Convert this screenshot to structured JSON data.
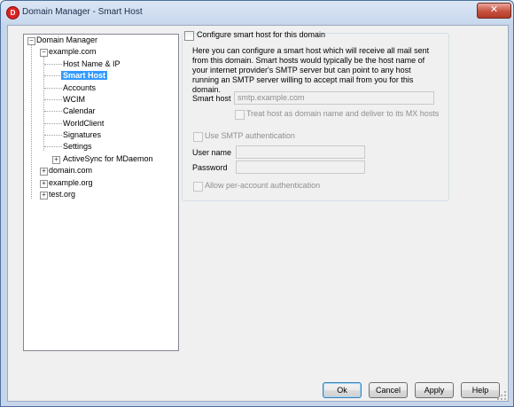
{
  "window": {
    "title": "Domain Manager - Smart Host",
    "close_glyph": "✕",
    "app_icon": "mdaemon-logo-icon",
    "app_icon_glyph": "D"
  },
  "tree": {
    "root": "Domain Manager",
    "domain": "example.com",
    "children": [
      "Host Name & IP",
      "Smart Host",
      "Accounts",
      "WCIM",
      "Calendar",
      "WorldClient",
      "Signatures",
      "Settings",
      "ActiveSync for MDaemon"
    ],
    "other_domains": [
      "domain.com",
      "example.org",
      "test.org"
    ],
    "expand_glyph": "+",
    "collapse_glyph": "−"
  },
  "panel": {
    "configure_label": "Configure smart host for this domain",
    "configure_checked": false,
    "description": "Here you can configure a smart host which will receive all mail sent from this domain.  Smart hosts would typically be the host name of your internet provider's SMTP server but can point to any host running an SMTP server willing to accept mail from you for this domain.",
    "smart_host_label": "Smart host",
    "smart_host_value": "smtp.example.com",
    "treat_host_label": "Treat host as domain name and deliver to its MX hosts",
    "use_smtp_auth_label": "Use SMTP authentication",
    "username_label": "User name",
    "username_value": "",
    "password_label": "Password",
    "password_value": "",
    "per_account_label": "Allow per-account authentication"
  },
  "buttons": {
    "ok": "Ok",
    "cancel": "Cancel",
    "apply": "Apply",
    "help": "Help"
  }
}
